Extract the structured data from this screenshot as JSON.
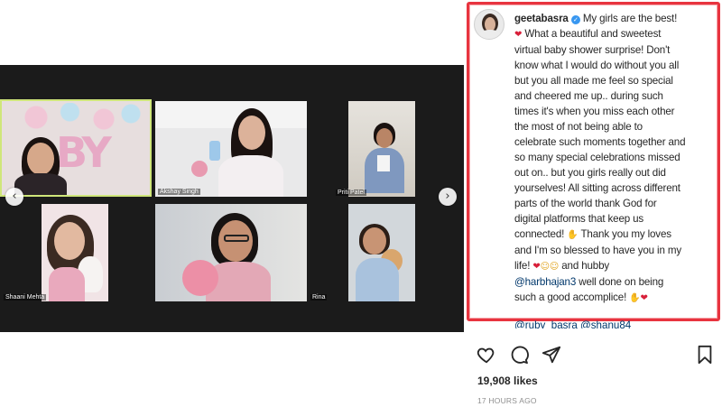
{
  "post": {
    "username": "geetabasra",
    "caption_lines": [
      "My girls are the best!",
      "What a beautiful and sweetest",
      "virtual baby shower surprise! Don't",
      "know what I would do without you all",
      "but you all made me feel so special",
      "and cheered me up.. during such",
      "times it's when you miss each other",
      "the most of not being able to",
      "celebrate such moments together and",
      "so many special celebrations missed",
      "out on.. but you girls really out did",
      "yourselves! All sitting across different",
      "parts of the world thank God for",
      "digital platforms that keep us",
      "connected!",
      "Thank you my loves",
      "and I'm so blessed to have you in my",
      "life!",
      "and hubby",
      "@harbhajan3",
      "well done on being",
      "such a good accomplice!"
    ],
    "overflow_mentions": "@ruby_basra @shanu84",
    "likes": "19,908 likes",
    "timestamp": "17 HOURS AGO"
  },
  "video_call": {
    "participants": [
      "Akshay Singh",
      "Priti Patel",
      "Shaani Mehta",
      "Rina"
    ]
  },
  "icons": {
    "like": "heart-icon",
    "comment": "comment-icon",
    "share": "share-icon",
    "save": "bookmark-icon",
    "prev": "chevron-left-icon",
    "next": "chevron-right-icon",
    "verified": "verified-badge-icon"
  },
  "colors": {
    "highlight_border": "#e8343f",
    "mention": "#00376b",
    "verified": "#3897f0"
  }
}
